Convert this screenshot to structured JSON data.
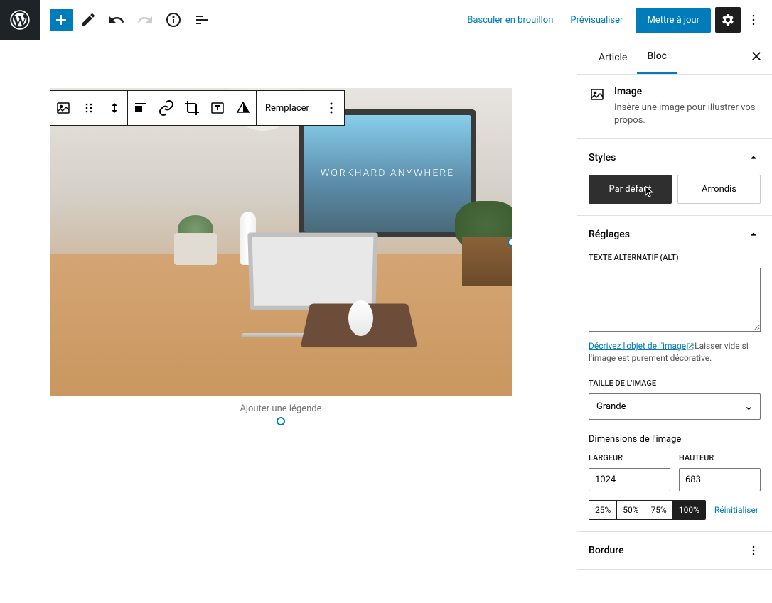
{
  "topbar": {
    "draft": "Basculer en brouillon",
    "preview": "Prévisualiser",
    "update": "Mettre à jour"
  },
  "block_toolbar": {
    "replace": "Remplacer"
  },
  "canvas": {
    "caption_placeholder": "Ajouter une légende",
    "monitor_text": "WORKHARD ANYWHERE"
  },
  "sidebar": {
    "tabs": {
      "article": "Article",
      "block": "Bloc"
    },
    "block_info": {
      "title": "Image",
      "desc": "Insère une image pour illustrer vos propos."
    },
    "styles": {
      "title": "Styles",
      "default": "Par défaut",
      "rounded": "Arrondis"
    },
    "settings": {
      "title": "Réglages",
      "alt_label": "TEXTE ALTERNATIF (ALT)",
      "alt_value": "",
      "alt_help_link": "Décrivez l'objet de l'image",
      "alt_help_text": "Laisser vide si l'image est purement décorative.",
      "size_label": "TAILLE DE L'IMAGE",
      "size_value": "Grande",
      "dimensions_title": "Dimensions de l'image",
      "width_label": "LARGEUR",
      "height_label": "HAUTEUR",
      "width_value": "1024",
      "height_value": "683",
      "pct": [
        "25%",
        "50%",
        "75%",
        "100%"
      ],
      "pct_active": "100%",
      "reset": "Réinitialiser"
    },
    "border": {
      "title": "Bordure"
    }
  }
}
